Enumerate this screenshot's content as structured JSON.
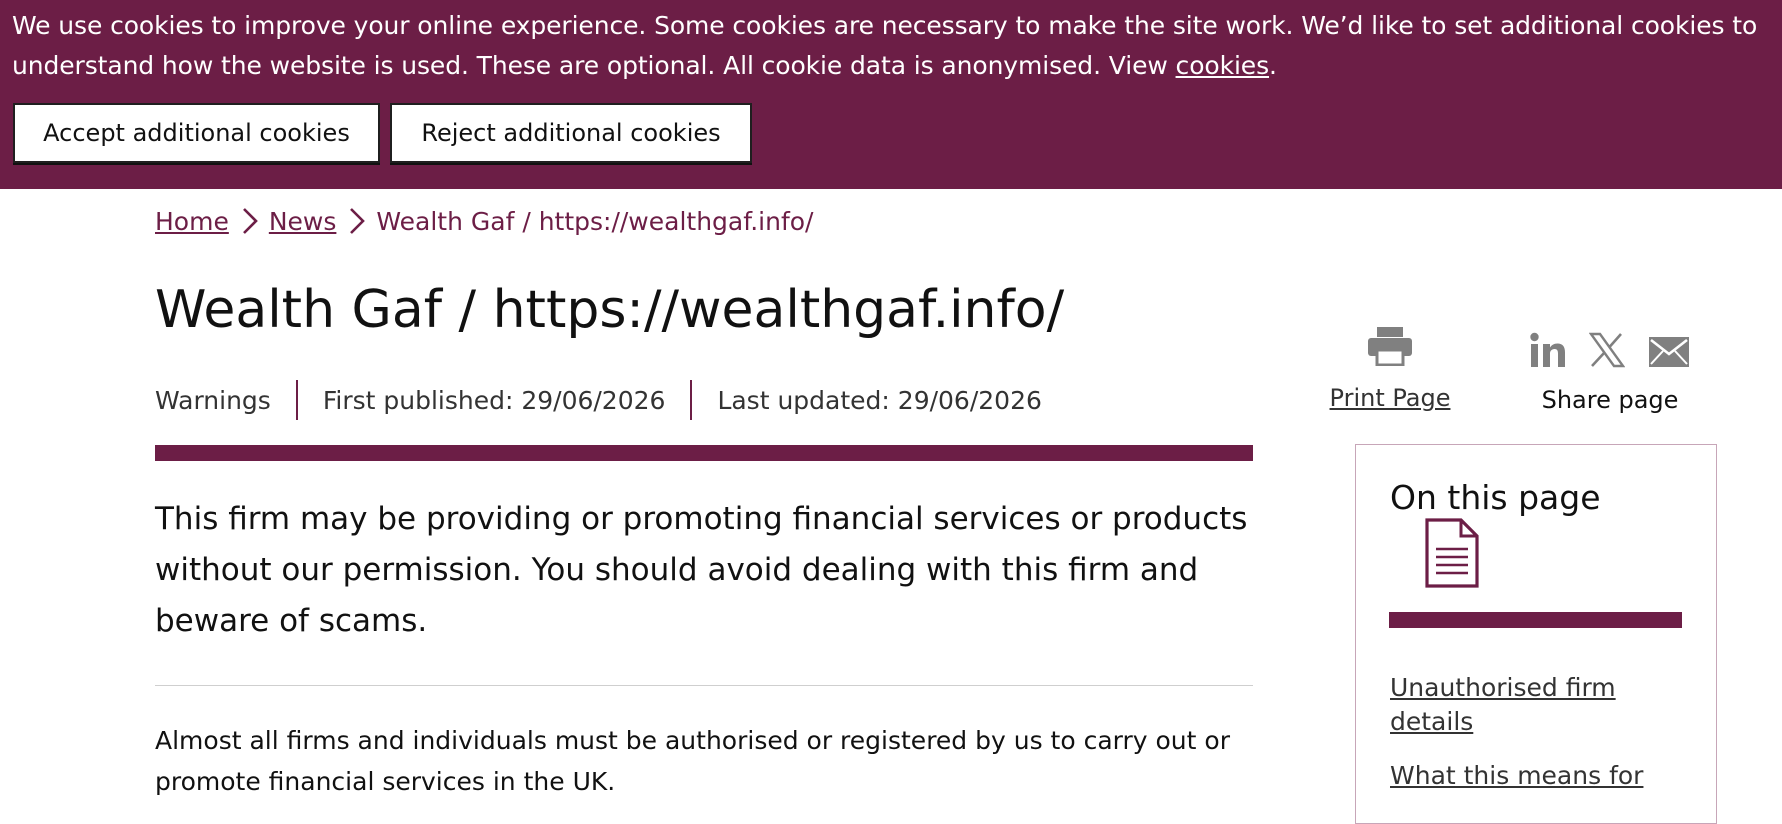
{
  "cookie_banner": {
    "message": "We use cookies to improve your online experience. Some cookies are necessary to make the site work. We’d like to set additional cookies to understand how the website is used. These are optional. All cookie data is anonymised. View ",
    "link_text": "cookies",
    "suffix": ".",
    "accept_label": "Accept additional cookies",
    "reject_label": "Reject additional cookies"
  },
  "breadcrumb": {
    "home": "Home",
    "news": "News",
    "current": "Wealth Gaf / https://wealthgaf.info/"
  },
  "page": {
    "title": "Wealth Gaf / https://wealthgaf.info/",
    "category": "Warnings",
    "first_published": "First published: 29/06/2026",
    "last_updated": "Last updated: 29/06/2026",
    "intro": "This firm may be providing or promoting financial services or products without our permission. You should avoid dealing with this firm and beware of scams.",
    "body": "Almost all firms and individuals must be authorised or registered by us to carry out or promote financial services in the UK."
  },
  "actions": {
    "print_label": "Print Page",
    "share_label": "Share page",
    "share_icons": [
      "linkedin-icon",
      "x-icon",
      "email-icon"
    ]
  },
  "on_this_page": {
    "title": "On this page",
    "links": [
      "Unauthorised firm details",
      "What this means for"
    ]
  },
  "colors": {
    "brand": "#6c1e46",
    "text": "#111111",
    "muted_icon": "#808080"
  }
}
